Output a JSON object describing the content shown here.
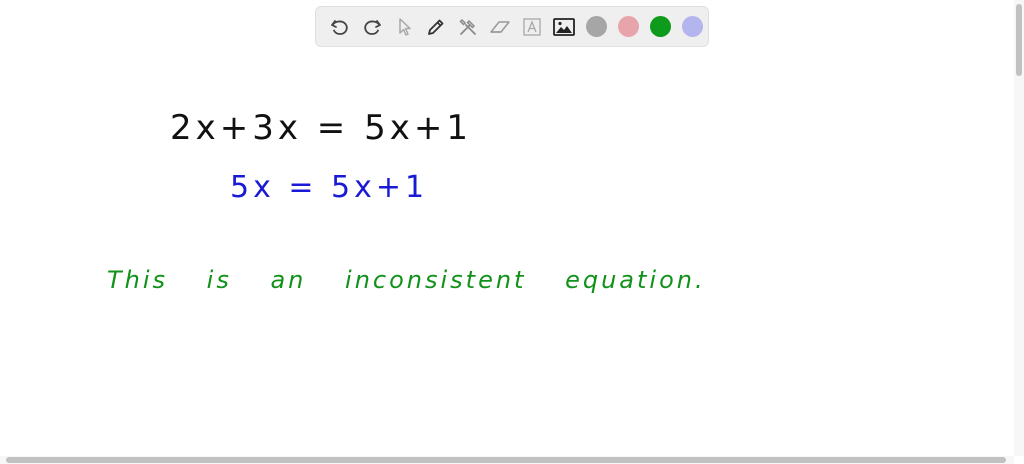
{
  "toolbar": {
    "tools": [
      {
        "name": "undo-icon",
        "label": "Undo"
      },
      {
        "name": "redo-icon",
        "label": "Redo"
      },
      {
        "name": "pointer-icon",
        "label": "Select"
      },
      {
        "name": "pen-icon",
        "label": "Pen"
      },
      {
        "name": "tools-icon",
        "label": "Tools"
      },
      {
        "name": "eraser-icon",
        "label": "Eraser"
      },
      {
        "name": "text-icon",
        "label": "Text"
      },
      {
        "name": "image-icon",
        "label": "Image"
      }
    ],
    "colors": [
      "#a6a6a6",
      "#e8a4ab",
      "#0e9a1a",
      "#b4b4ef"
    ]
  },
  "canvas": {
    "equation_line1": "2x+3x = 5x+1",
    "equation_line2": "5x = 5x+1",
    "conclusion": "This is an inconsistent equation.",
    "ink_colors": {
      "black": "#111111",
      "blue": "#1a1ad6",
      "green": "#12921a"
    }
  }
}
